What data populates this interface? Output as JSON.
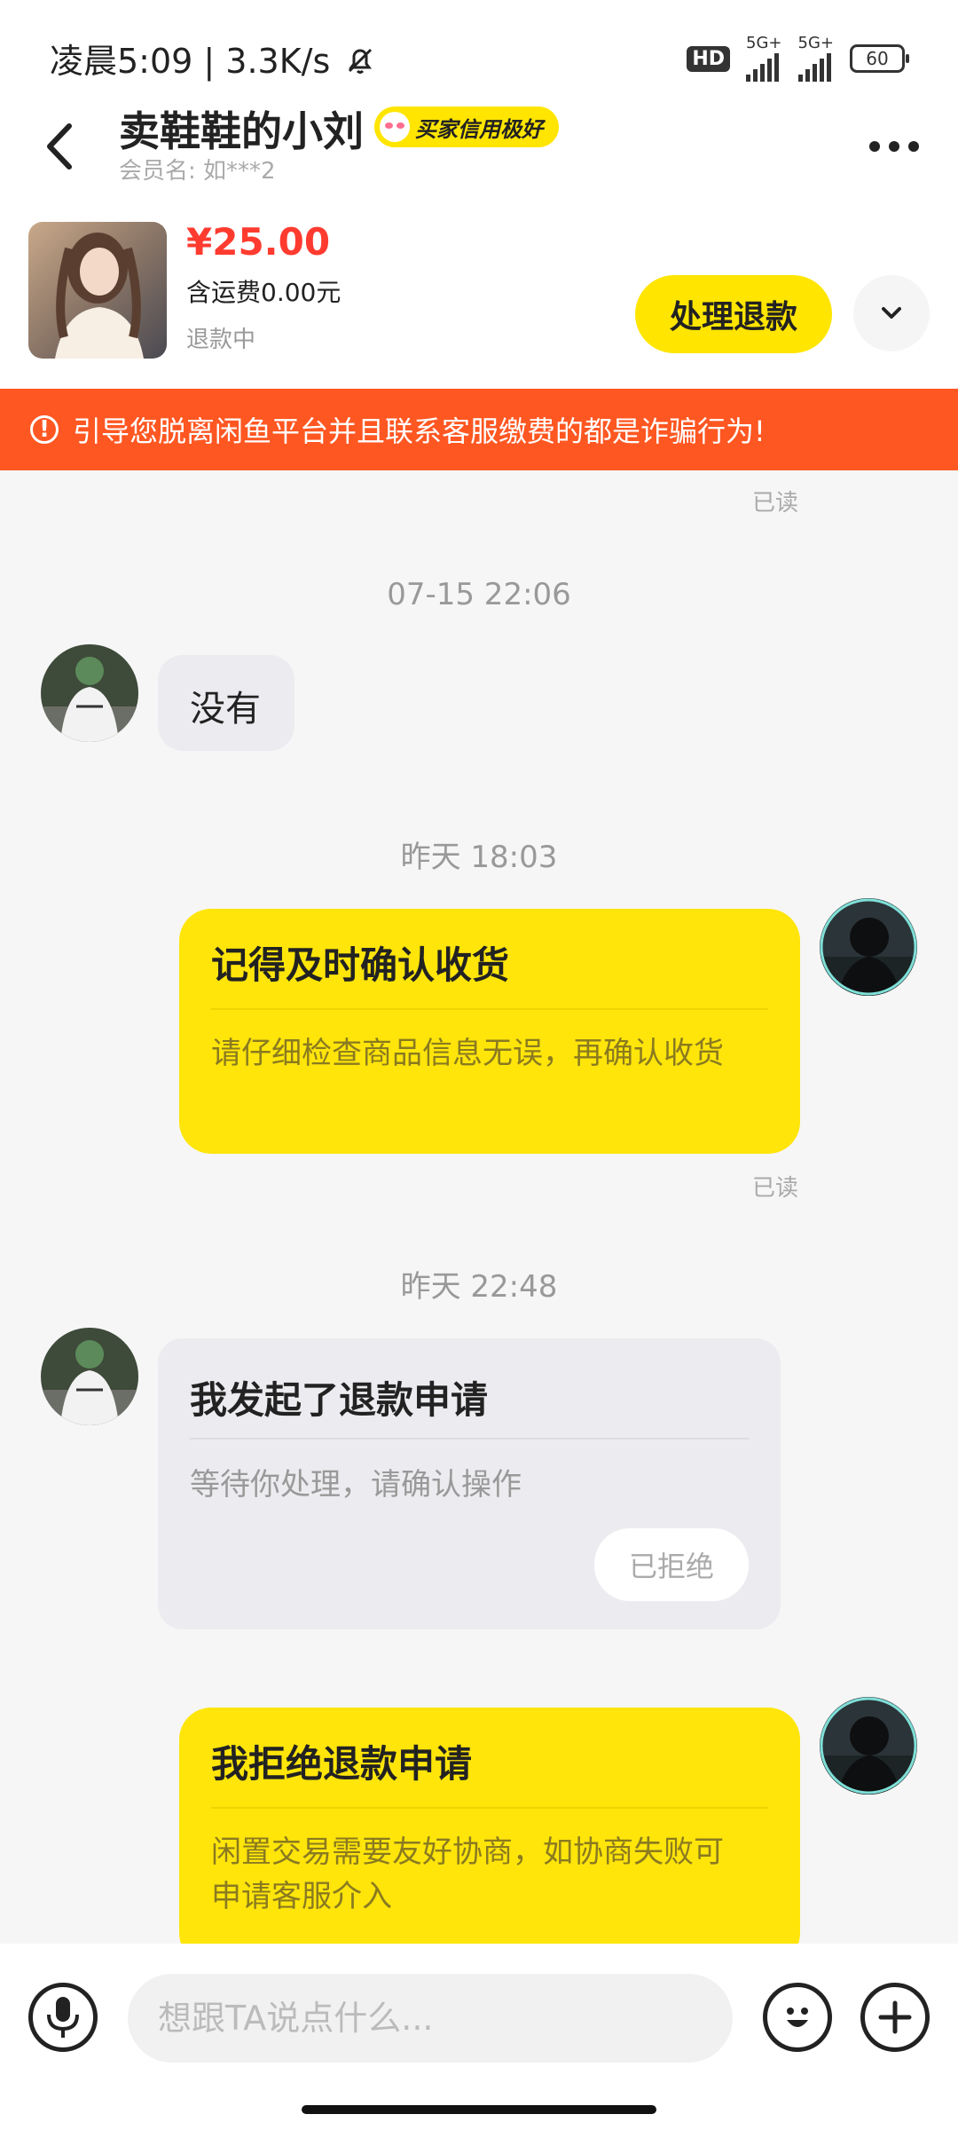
{
  "status_bar": {
    "time_speed": "凌晨5:09 | 3.3K/s",
    "hd": "HD",
    "net1": "5G+",
    "net2": "5G+",
    "battery": "60"
  },
  "header": {
    "title": "卖鞋鞋的小刘",
    "badge": "买家信用极好",
    "member": "会员名: 如***2"
  },
  "product": {
    "price": "¥25.00",
    "shipping": "含运费0.00元",
    "state": "退款中",
    "refund_button": "处理退款"
  },
  "warning": "引导您脱离闲鱼平台并且联系客服缴费的都是诈骗行为!",
  "messages": {
    "read_label": "已读",
    "time1": "07-15 22:06",
    "msg1": "没有",
    "time2": "昨天 18:03",
    "card1_title": "记得及时确认收货",
    "card1_desc": "请仔细检查商品信息无误，再确认收货",
    "time3": "昨天 22:48",
    "card2_title": "我发起了退款申请",
    "card2_desc": "等待你处理，请确认操作",
    "card2_status": "已拒绝",
    "card3_title": "我拒绝退款申请",
    "card3_desc": "闲置交易需要友好协商，如协商失败可申请客服介入"
  },
  "composer": {
    "placeholder": "想跟TA说点什么..."
  },
  "colors": {
    "accent_yellow": "#ffe500",
    "warning_orange": "#ff5722",
    "price_red": "#ff3b30"
  }
}
